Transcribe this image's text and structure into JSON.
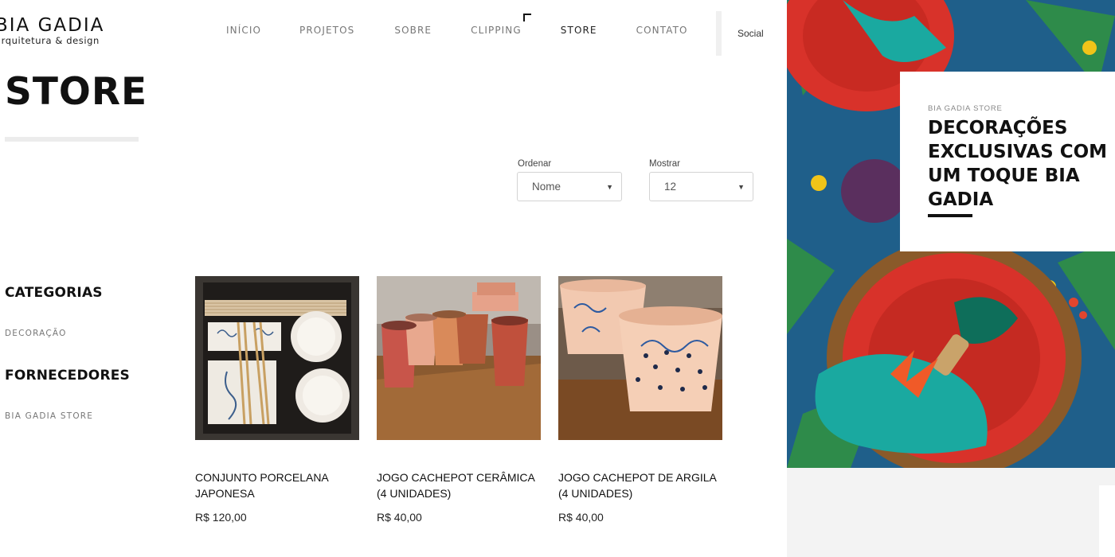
{
  "logo": {
    "name": "BIA GADIA",
    "subtitle": "arquitetura & design"
  },
  "nav": {
    "items": [
      {
        "label": "INÍCIO"
      },
      {
        "label": "PROJETOS"
      },
      {
        "label": "SOBRE"
      },
      {
        "label": "CLIPPING"
      },
      {
        "label": "STORE"
      },
      {
        "label": "CONTATO"
      }
    ],
    "active": "STORE",
    "social": "Social"
  },
  "page": {
    "title": "STORE"
  },
  "controls": {
    "sort": {
      "label": "Ordenar",
      "value": "Nome"
    },
    "show": {
      "label": "Mostrar",
      "value": "12"
    }
  },
  "sidebar": {
    "categories_heading": "CATEGORIAS",
    "categories": [
      "DECORAÇÃO"
    ],
    "suppliers_heading": "FORNECEDORES",
    "suppliers": [
      "BIA GADIA STORE"
    ]
  },
  "products": [
    {
      "name": "CONJUNTO PORCELANA JAPONESA",
      "price": "R$ 120,00",
      "image": "japanese-porcelain-set"
    },
    {
      "name": "JOGO CACHEPOT CERÂMICA (4 UNIDADES)",
      "price": "R$ 40,00",
      "image": "ceramic-cachepot-set"
    },
    {
      "name": "JOGO CACHEPOT DE ARGILA (4 UNIDADES)",
      "price": "R$ 40,00",
      "image": "clay-cachepot-set"
    }
  ],
  "banner": {
    "kicker": "BIA GADIA STORE",
    "headline": "DECORAÇÕES EXCLUSIVAS COM UM TOQUE BIA GADIA"
  },
  "colors": {
    "text": "#111111",
    "muted": "#777777",
    "accent_red": "#d8322a",
    "accent_teal": "#1aa9a0"
  }
}
